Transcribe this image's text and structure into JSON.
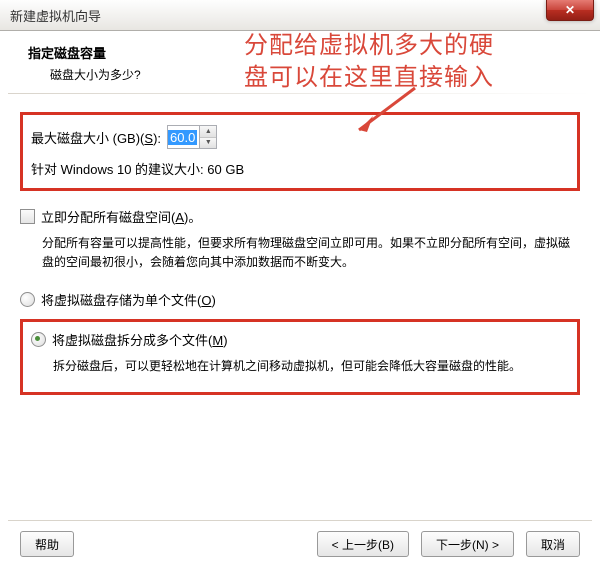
{
  "window": {
    "title": "新建虚拟机向导"
  },
  "annotation": {
    "line1": "分配给虚拟机多大的硬",
    "line2": "盘可以在这里直接输入"
  },
  "header": {
    "title": "指定磁盘容量",
    "subtitle": "磁盘大小为多少?"
  },
  "disk": {
    "label_prefix": "最大磁盘大小 (GB)(",
    "label_key": "S",
    "label_suffix": "):",
    "value": "60.0",
    "recommend": "针对 Windows 10 的建议大小: 60 GB"
  },
  "allocate_now": {
    "label_prefix": "立即分配所有磁盘空间(",
    "label_key": "A",
    "label_suffix": ")。",
    "desc": "分配所有容量可以提高性能，但要求所有物理磁盘空间立即可用。如果不立即分配所有空间，虚拟磁盘的空间最初很小，会随着您向其中添加数据而不断变大。"
  },
  "store_single": {
    "label_prefix": "将虚拟磁盘存储为单个文件(",
    "label_key": "O",
    "label_suffix": ")"
  },
  "store_split": {
    "label_prefix": "将虚拟磁盘拆分成多个文件(",
    "label_key": "M",
    "label_suffix": ")",
    "desc": "拆分磁盘后，可以更轻松地在计算机之间移动虚拟机，但可能会降低大容量磁盘的性能。"
  },
  "buttons": {
    "help": "帮助",
    "back": "< 上一步(B)",
    "next": "下一步(N) >",
    "cancel": "取消"
  }
}
